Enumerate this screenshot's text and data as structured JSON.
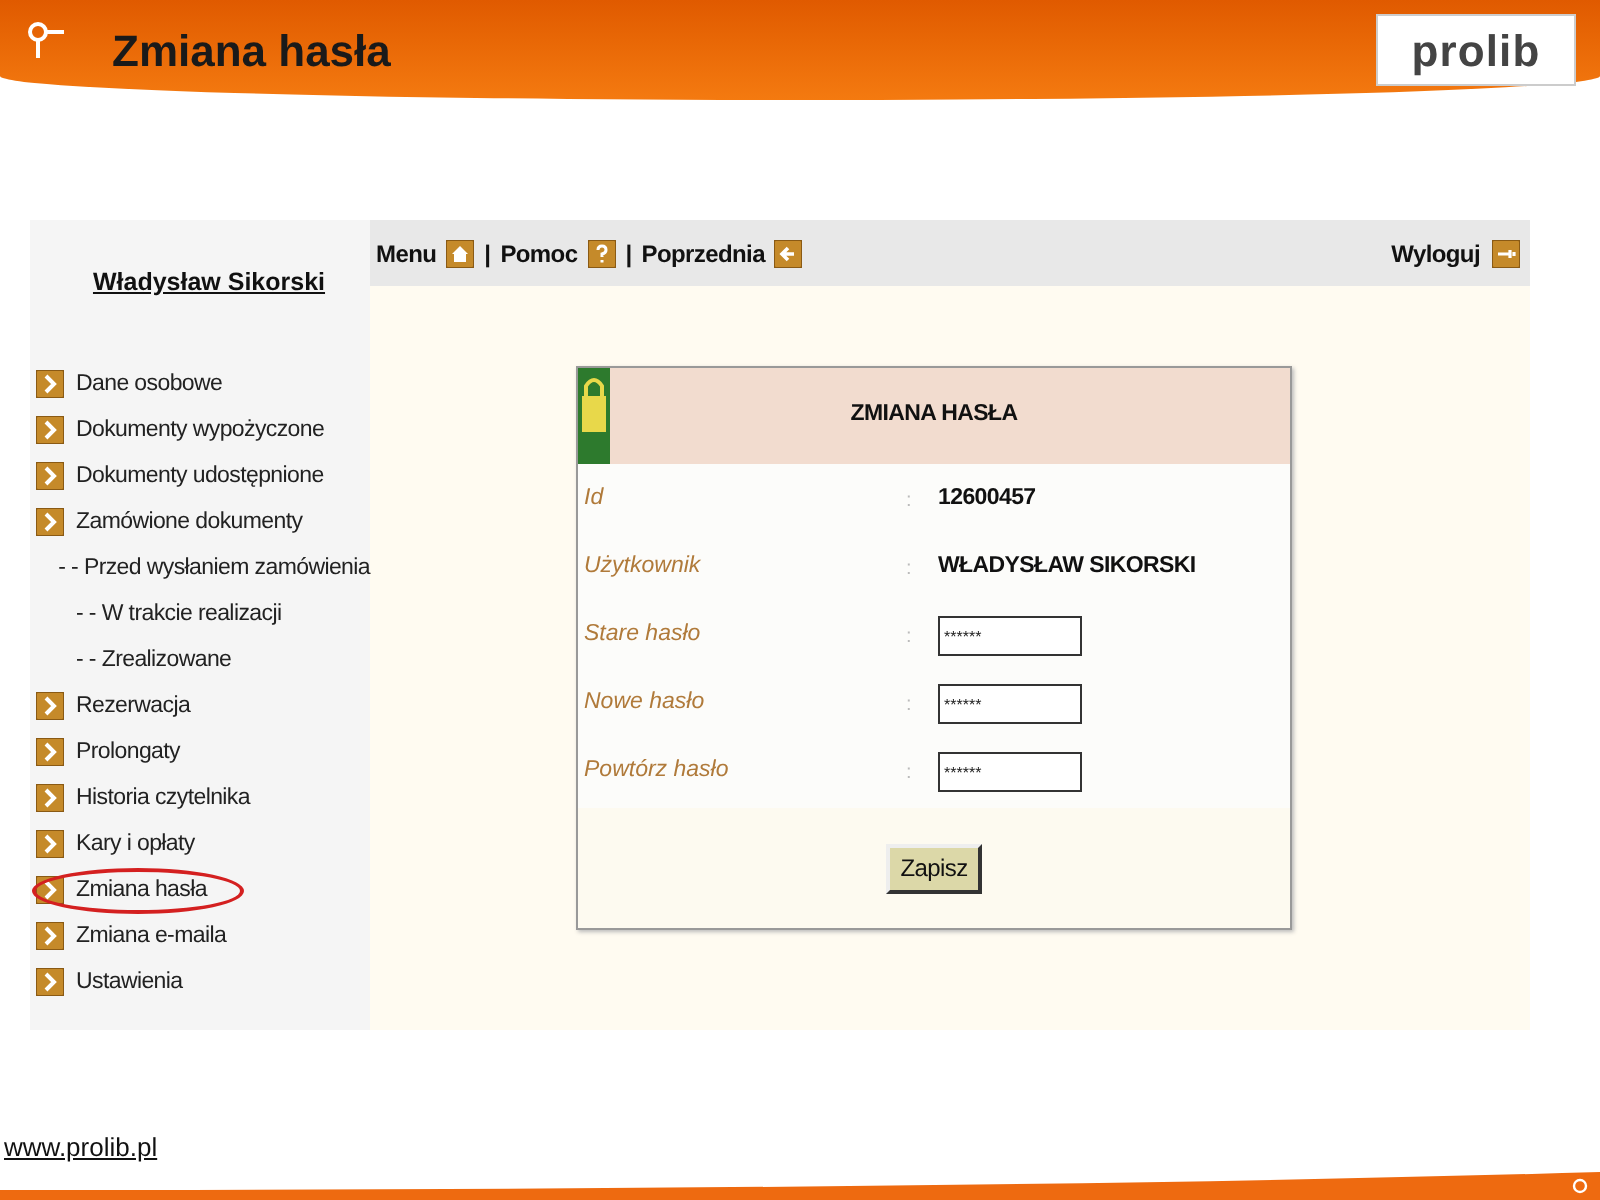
{
  "slide": {
    "title": "Zmiana hasła",
    "logo": "prolib",
    "footer_link": "www.prolib.pl"
  },
  "sidebar": {
    "user": "Władysław Sikorski",
    "items": [
      {
        "label": "Dane osobowe",
        "kind": "main",
        "selected": false
      },
      {
        "label": "Dokumenty wypożyczone",
        "kind": "main",
        "selected": false
      },
      {
        "label": "Dokumenty udostępnione",
        "kind": "main",
        "selected": false
      },
      {
        "label": "Zamówione dokumenty",
        "kind": "main",
        "selected": false
      },
      {
        "label": "- - Przed wysłaniem zamówienia",
        "kind": "sub",
        "selected": false
      },
      {
        "label": "- - W trakcie realizacji",
        "kind": "sub",
        "selected": false
      },
      {
        "label": "- - Zrealizowane",
        "kind": "sub",
        "selected": false
      },
      {
        "label": "Rezerwacja",
        "kind": "main",
        "selected": false
      },
      {
        "label": "Prolongaty",
        "kind": "main",
        "selected": false
      },
      {
        "label": "Historia czytelnika",
        "kind": "main",
        "selected": false
      },
      {
        "label": "Kary i opłaty",
        "kind": "main",
        "selected": false
      },
      {
        "label": "Zmiana hasła",
        "kind": "main",
        "selected": true
      },
      {
        "label": "Zmiana e-maila",
        "kind": "main",
        "selected": false
      },
      {
        "label": "Ustawienia",
        "kind": "main",
        "selected": false
      }
    ]
  },
  "toolbar": {
    "left": [
      {
        "label": "Menu",
        "kind": "home"
      },
      {
        "label": "Pomoc",
        "kind": "help"
      },
      {
        "label": "Poprzednia",
        "kind": "back"
      }
    ],
    "separator": "|",
    "right": {
      "label": "Wyloguj",
      "kind": "logout"
    }
  },
  "form": {
    "title": "ZMIANA HASŁA",
    "separator": ":",
    "rows": [
      {
        "label": "Id",
        "kind": "text",
        "value": "12600457"
      },
      {
        "label": "Użytkownik",
        "kind": "text",
        "value": "WŁADYSŁAW SIKORSKI"
      },
      {
        "label": "Stare hasło",
        "kind": "password",
        "value": "******"
      },
      {
        "label": "Nowe hasło",
        "kind": "password",
        "value": "******"
      },
      {
        "label": "Powtórz hasło",
        "kind": "password",
        "value": "******"
      }
    ],
    "button": "Zapisz"
  }
}
